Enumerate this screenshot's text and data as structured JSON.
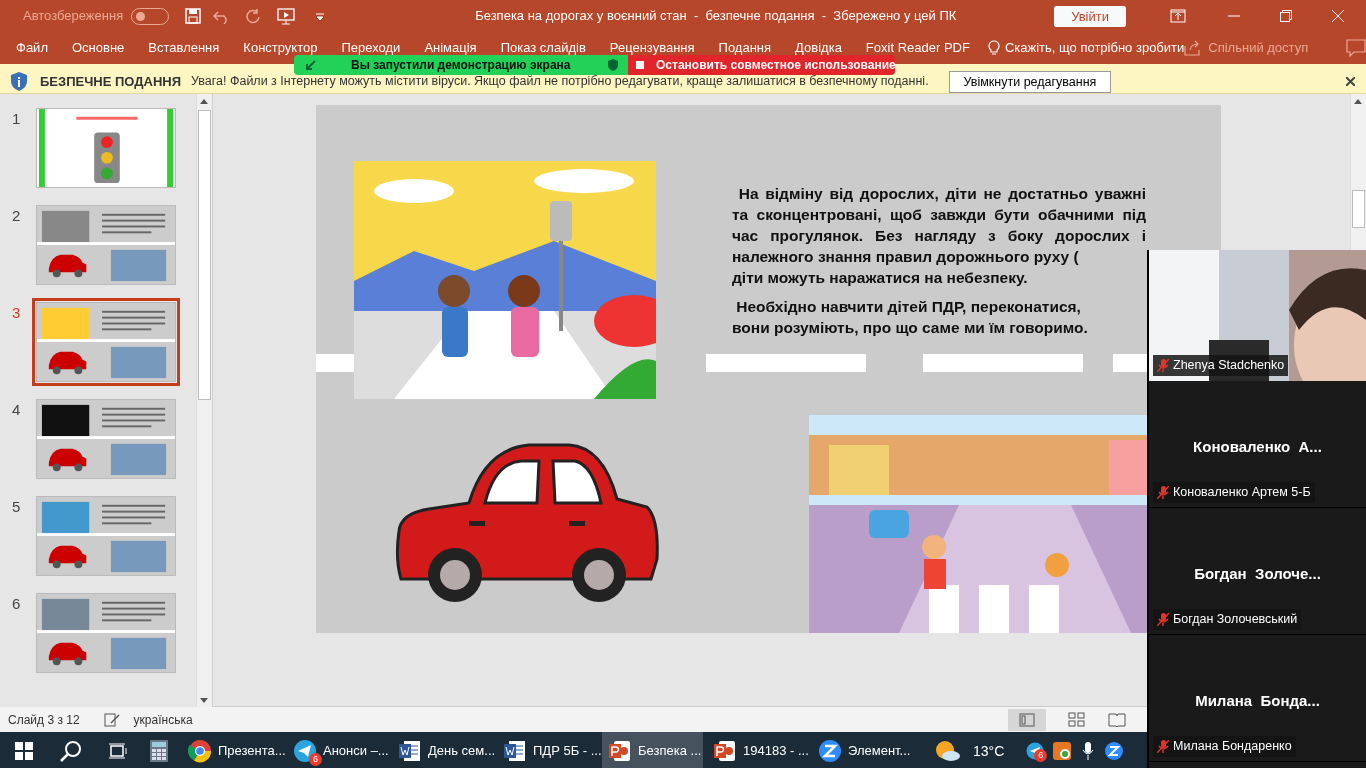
{
  "title_bar": {
    "autosave_label": "Автозбереження",
    "autosave_on": false,
    "title": "Безпека на дорогах у воєнний стан  -  безпечне подання  -  Збережено у цей ПК",
    "sign_in": "Увійти"
  },
  "ribbon": {
    "tabs": [
      {
        "label": "Файл",
        "selected": false
      },
      {
        "label": "Основне",
        "selected": false
      },
      {
        "label": "Вставлення",
        "selected": false
      },
      {
        "label": "Конструктор",
        "selected": false
      },
      {
        "label": "Переходи",
        "selected": false
      },
      {
        "label": "Анімація",
        "selected": false
      },
      {
        "label": "Показ слайдів",
        "selected": false
      },
      {
        "label": "Рецензування",
        "selected": false
      },
      {
        "label": "Подання",
        "selected": false
      },
      {
        "label": "Довідка",
        "selected": false
      },
      {
        "label": "Foxit Reader PDF",
        "selected": false
      }
    ],
    "tell_me": "Скажіть, що потрібно зробити",
    "share": "Спільний доступ"
  },
  "screen_share": {
    "status": "Вы запустили демонстрацию экрана",
    "stop": "Остановить совместное использование"
  },
  "message_bar": {
    "title": "БЕЗПЕЧНЕ ПОДАННЯ",
    "text": "Увага! Файли з Інтернету можуть містити віруси. Якщо файл не потрібно редагувати, краще залишатися в безпечному поданні.",
    "button": "Увімкнути редагування"
  },
  "thumbnails": [
    {
      "number": "1",
      "selected": false
    },
    {
      "number": "2",
      "selected": false
    },
    {
      "number": "3",
      "selected": true
    },
    {
      "number": "4",
      "selected": false
    },
    {
      "number": "5",
      "selected": false
    },
    {
      "number": "6",
      "selected": false
    }
  ],
  "slide": {
    "paragraphs": [
      "На відміну від дорослих, діти не достатньо уважні та сконцентровані, щоб завжди бути обачними під час прогулянок. Без нагляду з боку дорослих і належного знання правил дорожнього руху (",
      "діти можуть наражатися на небезпеку.",
      "Необхідно навчити дітей ПДР, переконатися,",
      "вони розуміють, про що саме ми їм говоримо."
    ]
  },
  "status_bar": {
    "slide_info": "Слайд 3 з 12",
    "language": "українська"
  },
  "participants": [
    {
      "kind": "video",
      "name": "Zhenya Stadchenko",
      "muted": true
    },
    {
      "kind": "tile",
      "display": "Коноваленко  А...",
      "name": "Коноваленко Артем 5-Б",
      "muted": true
    },
    {
      "kind": "tile",
      "display": "Богдан  Золоче...",
      "name": "Богдан Золочевський",
      "muted": true
    },
    {
      "kind": "tile",
      "display": "Милана  Бонда...",
      "name": "Милана Бондаренко",
      "muted": true
    }
  ],
  "taskbar": {
    "apps": [
      {
        "kind": "chrome",
        "label": "Презента...",
        "selected": false
      },
      {
        "kind": "telegram",
        "label": "Анонси –...",
        "badge": "6",
        "selected": false
      },
      {
        "kind": "word",
        "label": "День сем...",
        "selected": false
      },
      {
        "kind": "word",
        "label": "ПДР 5Б - ...",
        "selected": false
      },
      {
        "kind": "powerpoint",
        "label": "Безпека ...",
        "selected": true
      },
      {
        "kind": "powerpoint",
        "label": "194183  - ...",
        "selected": false
      },
      {
        "kind": "zoom",
        "label": "Элемент...",
        "selected": false
      }
    ],
    "weather": "13°C",
    "tray_badge": "6"
  }
}
